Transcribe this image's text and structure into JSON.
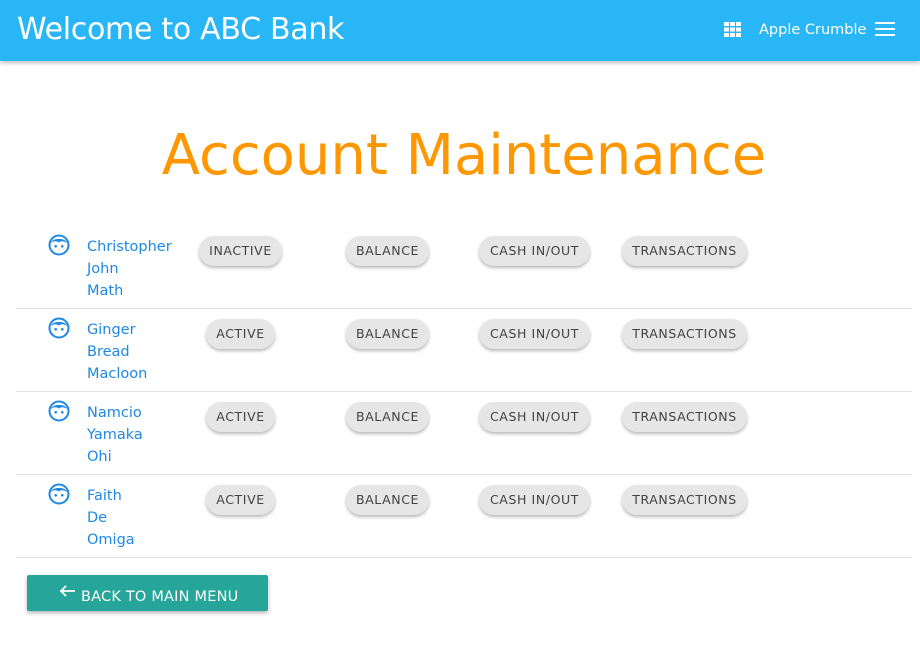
{
  "header": {
    "title": "Welcome to ABC Bank",
    "user_name": "Apple Crumble",
    "icons": {
      "apps": "apps-grid-icon",
      "menu": "hamburger-menu-icon"
    }
  },
  "page": {
    "title": "Account Maintenance"
  },
  "buttons": {
    "balance": "BALANCE",
    "cash": "CASH IN/OUT",
    "transactions": "TRANSACTIONS"
  },
  "accounts": [
    {
      "name": [
        "Christopher",
        "John",
        "Math"
      ],
      "status": "INACTIVE"
    },
    {
      "name": [
        "Ginger",
        "Bread",
        "Macloon"
      ],
      "status": "ACTIVE"
    },
    {
      "name": [
        "Namcio",
        "Yamaka",
        "Ohi"
      ],
      "status": "ACTIVE"
    },
    {
      "name": [
        "Faith",
        "De",
        "Omiga"
      ],
      "status": "ACTIVE"
    }
  ],
  "footer": {
    "back_label": "BACK TO MAIN MENU"
  },
  "colors": {
    "appbar": "#29b6f6",
    "title": "#ff9800",
    "link": "#1e88e5",
    "back_button": "#26a69a",
    "chip": "#e6e6e6"
  }
}
